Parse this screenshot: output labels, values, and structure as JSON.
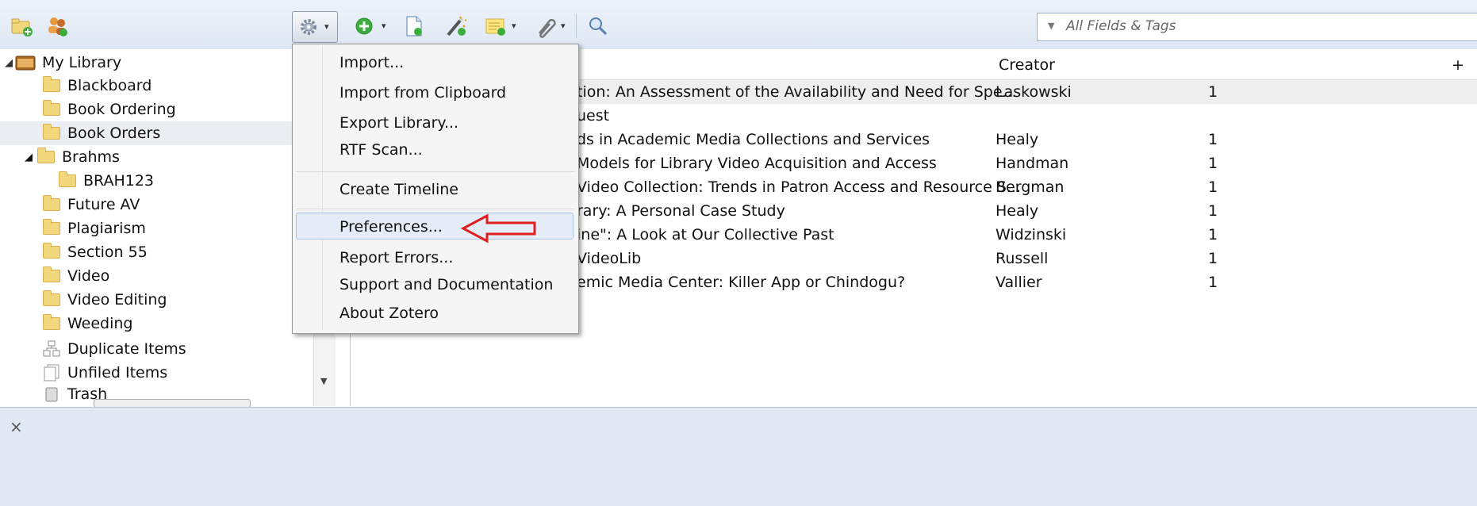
{
  "toolbar": {
    "icons": [
      "new-collection-icon",
      "new-group-icon",
      "actions-gear-icon",
      "new-item-icon",
      "new-note-icon",
      "add-by-identifier-icon",
      "new-standalone-note-icon",
      "add-attachment-icon",
      "advanced-search-icon"
    ],
    "search_placeholder": "All Fields & Tags"
  },
  "collections": {
    "root": "My Library",
    "items": [
      "Blackboard",
      "Book Ordering",
      "Book Orders",
      "Brahms",
      "BRAH123",
      "Future AV",
      "Plagiarism",
      "Section 55",
      "Video",
      "Video Editing",
      "Weeding",
      "Duplicate Items",
      "Unfiled Items",
      "Trash"
    ]
  },
  "items_table": {
    "headers": {
      "title": "",
      "creator": "Creator",
      "extra": "+"
    },
    "rows": [
      {
        "title": "tion: An Assessment of the Availability and Need for Spe...",
        "creator": "Laskowski",
        "count": "1"
      },
      {
        "title": "uest",
        "creator": "",
        "count": ""
      },
      {
        "title": "ds in Academic Media Collections and Services",
        "creator": "Healy",
        "count": "1"
      },
      {
        "title": "Models for Library Video Acquisition and Access",
        "creator": "Handman",
        "count": "1"
      },
      {
        "title": "Video Collection: Trends in Patron Access and Resource S...",
        "creator": "Bergman",
        "count": "1"
      },
      {
        "title": "rary: A Personal Case Study",
        "creator": "Healy",
        "count": "1"
      },
      {
        "title": "ine\": A Look at Our Collective Past",
        "creator": "Widzinski",
        "count": "1"
      },
      {
        "title": "VideoLib",
        "creator": "Russell",
        "count": "1"
      },
      {
        "title": "emic Media Center: Killer App or Chindogu?",
        "creator": "Vallier",
        "count": "1"
      }
    ]
  },
  "actions_menu": {
    "items": [
      "Import...",
      "Import from Clipboard",
      "Export Library...",
      "RTF Scan...",
      "Create Timeline",
      "Preferences...",
      "Report Errors...",
      "Support and Documentation",
      "About Zotero"
    ],
    "highlighted": "Preferences..."
  },
  "status_bar": {
    "close_glyph": "×"
  },
  "colors": {
    "annotation_arrow": "#e02020",
    "menu_highlight": "#e3ecf7"
  }
}
